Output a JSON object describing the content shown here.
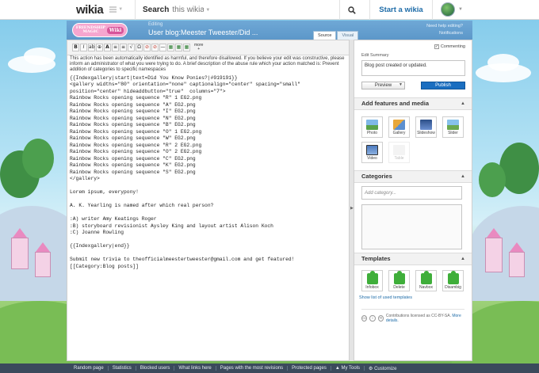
{
  "topbar": {
    "logo": "wikia",
    "search_label": "Search",
    "search_placeholder": "this wikia",
    "start_wiki": "Start a wikia"
  },
  "editor": {
    "logo_line1": "FRIENDSHIP",
    "logo_line2": "MAGIC",
    "logo_badge": "Wiki",
    "editing_label": "Editing",
    "title": "User blog:Meester Tweester/Did ...",
    "tab_source": "Source",
    "tab_visual": "Visual",
    "help_link": "Need help editing?",
    "notifications_link": "Notifications",
    "toolbar_more": "more",
    "toolbar_buttons": [
      "B",
      "I",
      "ab",
      "⊕",
      "A",
      "≡",
      "≡",
      "√",
      "Ω",
      "⊘",
      "⊘",
      "—",
      "▦",
      "▦",
      "▦"
    ],
    "warning": "This action has been automatically identified as harmful, and therefore disallowed. If you believe your edit was constructive, please inform an administrator of what you were trying to do. A brief description of the abuse rule which your action matched is: Prevent addition of categories to specific namespaces",
    "code_lines": [
      "{{Indexgallery|start|text=Did You Know Ponies?|#919191}}",
      "<gallery widths=\"80\" orientation=\"none\" captionalign=\"center\" spacing=\"small\"",
      "position=\"center\" hideaddbutton=\"true\"  columns=\"7\">",
      "Rainbow Rocks opening sequence \"R\" 1 EG2.png",
      "Rainbow Rocks opening sequence \"A\" EG2.png",
      "Rainbow Rocks opening sequence \"I\" EG2.png",
      "Rainbow Rocks opening sequence \"N\" EG2.png",
      "Rainbow Rocks opening sequence \"B\" EG2.png",
      "Rainbow Rocks opening sequence \"O\" 1 EG2.png",
      "Rainbow Rocks opening sequence \"W\" EG2.png",
      "Rainbow Rocks opening sequence \"R\" 2 EG2.png",
      "Rainbow Rocks opening sequence \"O\" 2 EG2.png",
      "Rainbow Rocks opening sequence \"C\" EG2.png",
      "Rainbow Rocks opening sequence \"K\" EG2.png",
      "Rainbow Rocks opening sequence \"S\" EG2.png",
      "</gallery>",
      "",
      "Lorem ipsum, everypony!",
      "",
      "A. K. Yearling is named after which real person?",
      "",
      ":A) writer Amy Keatings Roger",
      ":B) storyboard revisionist Aysley King and layout artist Alison Koch",
      ":C) Joanne Rowling",
      "",
      "{{Indexgallery|end}}",
      "",
      "Submit new trivia to theofficialmeestertweester@gmail.com and get featured!",
      "[[Category:Blog posts]]"
    ]
  },
  "rail": {
    "commenting_label": "Commenting",
    "commenting_checked": "✓",
    "summary_label": "Edit Summary",
    "summary_value": "Blog post created or updated.",
    "preview_label": "Preview",
    "publish_label": "Publish",
    "features_heading": "Add features and media",
    "media_tiles": [
      {
        "label": "Photo",
        "icon": "photo-icon"
      },
      {
        "label": "Gallery",
        "icon": "gallery-icon"
      },
      {
        "label": "Slideshow",
        "icon": "slideshow-icon"
      },
      {
        "label": "Slider",
        "icon": "slider-icon"
      },
      {
        "label": "Video",
        "icon": "video-icon"
      },
      {
        "label": "Table",
        "icon": "table-icon"
      }
    ],
    "categories_heading": "Categories",
    "category_placeholder": "Add category...",
    "templates_heading": "Templates",
    "templates": [
      "Infobox",
      "Delete",
      "Navbox",
      "Disambig"
    ],
    "templates_link": "Show list of used templates",
    "license_text": "Contributions licensed as CC-BY-SA.",
    "license_more": "More details."
  },
  "bottombar": {
    "items": [
      "Random page",
      "Statistics",
      "Blocked users",
      "What links here",
      "Pages with the most revisions",
      "Protected pages",
      "My Tools",
      "Customize"
    ]
  },
  "colors": {
    "publish": "#1a6ec0",
    "header": "#5c97c9",
    "bottom_bar": "#3b4a5c",
    "template_icon": "#3fae3a"
  }
}
